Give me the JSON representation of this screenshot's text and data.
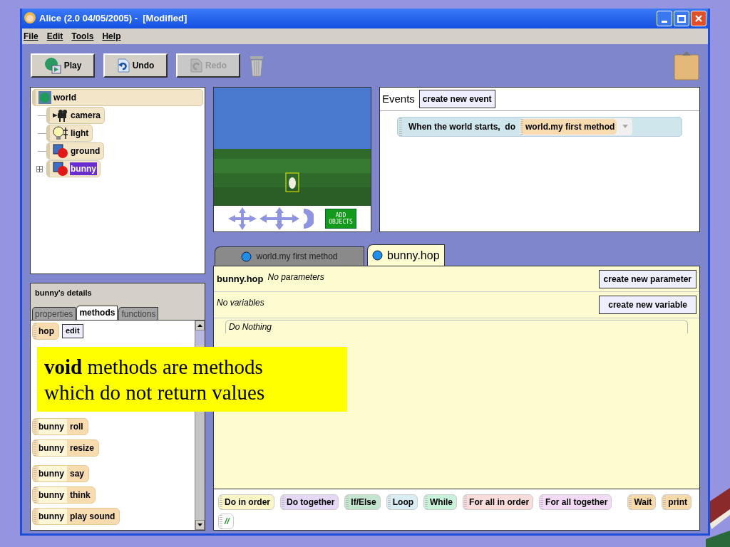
{
  "window": {
    "title": "Alice (2.0 04/05/2005) -  [Modified]"
  },
  "menu": [
    "File",
    "Edit",
    "Tools",
    "Help"
  ],
  "toolbar": [
    {
      "label": "Play",
      "kind": "play",
      "disabled": false
    },
    {
      "label": "Undo",
      "kind": "undo",
      "disabled": false
    },
    {
      "label": "Redo",
      "kind": "redo",
      "disabled": true
    }
  ],
  "object_tree": [
    {
      "label": "world",
      "kind": "world",
      "selected": false,
      "children": [
        {
          "label": "camera",
          "kind": "camera",
          "selected": false
        },
        {
          "label": "light",
          "kind": "light",
          "selected": false
        },
        {
          "label": "ground",
          "kind": "object",
          "selected": false
        },
        {
          "label": "bunny",
          "kind": "object",
          "selected": true
        }
      ]
    }
  ],
  "scene": {
    "add_objects_button": "ADD OBJECTS"
  },
  "events": {
    "title": "Events",
    "button": "create new event",
    "rows": [
      {
        "text": "When the world starts,  do",
        "method": "world.my first method"
      }
    ]
  },
  "details": {
    "title": "bunny's details",
    "tabs": [
      {
        "label": "properties",
        "selected": false
      },
      {
        "label": "methods",
        "selected": true
      },
      {
        "label": "functions",
        "selected": false
      }
    ],
    "methods": [
      {
        "name": "hop",
        "edit": "edit"
      },
      {
        "object": "bunny",
        "name": "roll"
      },
      {
        "object": "bunny",
        "name": "resize"
      },
      {
        "object": "bunny",
        "name": "say"
      },
      {
        "object": "bunny",
        "name": "think"
      },
      {
        "object": "bunny",
        "name": "play sound"
      }
    ]
  },
  "editor_tabs": [
    {
      "label": "world.my first method",
      "selected": false
    },
    {
      "label": "bunny.hop",
      "selected": true
    }
  ],
  "editor": {
    "method_name": "bunny.hop",
    "parameters": "No parameters",
    "parameter_button": "create new parameter",
    "variables": "No variables",
    "variable_button": "create new variable",
    "body": "Do Nothing"
  },
  "palette": [
    {
      "label": "Do in order",
      "color": "#fbf6c6"
    },
    {
      "label": "Do together",
      "color": "#e4d8f6"
    },
    {
      "label": "If/Else",
      "color": "#c4e6d0"
    },
    {
      "label": "Loop",
      "color": "#d8eef3"
    },
    {
      "label": "While",
      "color": "#c8f2da"
    },
    {
      "label": "For all in order",
      "color": "#fadcdc"
    },
    {
      "label": "For all together",
      "color": "#f3daf6"
    },
    {
      "label": "Wait",
      "color": "#f8d9a9"
    },
    {
      "label": "print",
      "color": "#f8d9a9"
    },
    {
      "label": "//",
      "color": "#ffffff"
    }
  ],
  "callout": "**void** methods are methods which do not return values"
}
